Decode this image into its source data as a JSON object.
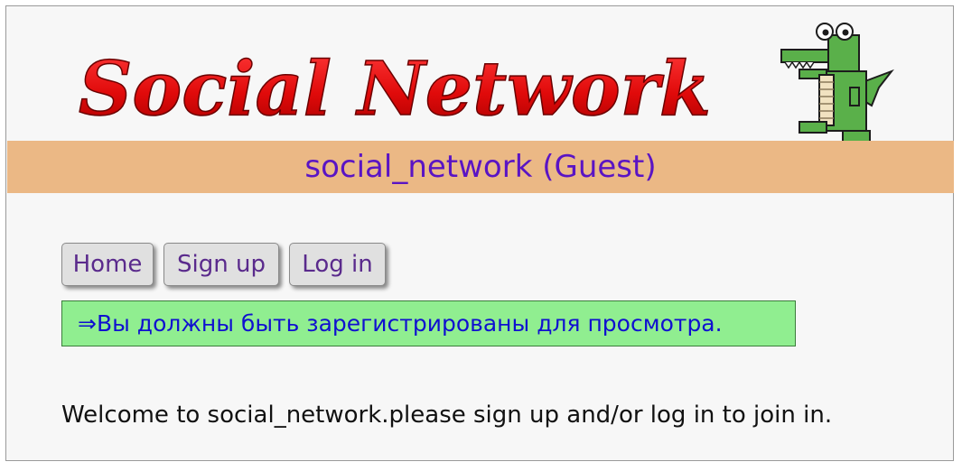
{
  "header": {
    "logo_text": "Social Network",
    "mascot_icon": "crocodile-mascot-icon"
  },
  "banner": {
    "title": "social_network (Guest)"
  },
  "nav": {
    "items": [
      {
        "label": "Home"
      },
      {
        "label": "Sign up"
      },
      {
        "label": "Log in"
      }
    ]
  },
  "notice": {
    "text": "⇒Вы должны быть зарегистрированы для просмотра."
  },
  "welcome": {
    "text": "Welcome to social_network.please sign up and/or log in to join in."
  },
  "colors": {
    "banner_bg": "#ebb885",
    "banner_text": "#5a14c4",
    "logo_red": "#e01010",
    "notice_bg": "#90ee90",
    "notice_text": "#1010d0",
    "nav_text": "#5a2a8c"
  }
}
